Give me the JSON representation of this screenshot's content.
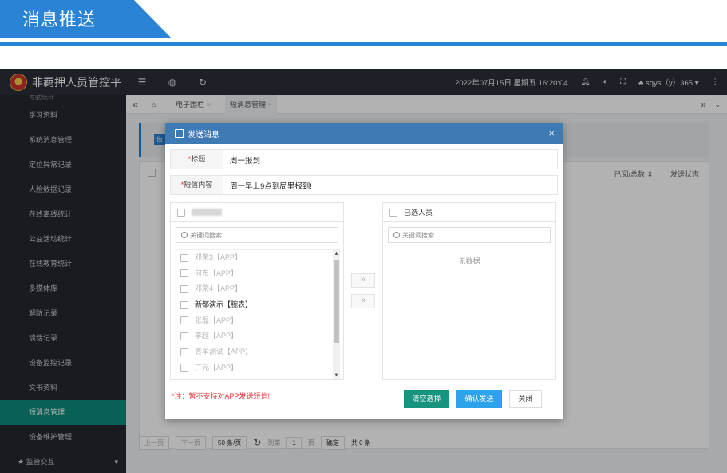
{
  "banner": {
    "title": "消息推送"
  },
  "app": {
    "title": "非羁押人员管控平",
    "datetime": "2022年07月15日 星期五 16:20:04",
    "user": "sqys（y）365"
  },
  "sidebar": {
    "items": [
      {
        "label": "考勤统计",
        "state": "cut"
      },
      {
        "label": "学习资料"
      },
      {
        "label": "系统消息管理"
      },
      {
        "label": "定位异常记录"
      },
      {
        "label": "人脸数据记录"
      },
      {
        "label": "在线离线统计"
      },
      {
        "label": "公益活动统计"
      },
      {
        "label": "在线教育统计"
      },
      {
        "label": "多媒体库"
      },
      {
        "label": "解防记录"
      },
      {
        "label": "谈话记录"
      },
      {
        "label": "设备监控记录"
      },
      {
        "label": "文书资料"
      },
      {
        "label": "短消息管理",
        "state": "active"
      },
      {
        "label": "设备维护管理"
      },
      {
        "label": "监管交互",
        "state": "group"
      }
    ]
  },
  "tabs": {
    "items": [
      "电子围栏",
      "短消息管理"
    ]
  },
  "main": {
    "col_read": "已阅/总数",
    "col_status": "发送状态",
    "tag": "告"
  },
  "pager": {
    "prev": "上一页",
    "next": "下一页",
    "per_page": "50 条/页",
    "goto": "到第",
    "page": "1",
    "page_unit": "页",
    "confirm": "确定",
    "total": "共 0 条"
  },
  "dialog": {
    "title": "发送消息",
    "subject_label": "标题",
    "subject_value": "周一报到",
    "content_label": "短信内容",
    "content_value": "周一早上9点到局里报到!",
    "left_search_placeholder": "关键词搜索",
    "right_header": "已选人员",
    "right_search_placeholder": "关键词搜索",
    "no_data": "无数据",
    "list": [
      {
        "name": "邓荣3【APP】",
        "enabled": false
      },
      {
        "name": "何东【APP】",
        "enabled": false
      },
      {
        "name": "邓荣4【APP】",
        "enabled": false
      },
      {
        "name": "新都演示【腕表】",
        "enabled": true
      },
      {
        "name": "张磊【APP】",
        "enabled": false
      },
      {
        "name": "李超【APP】",
        "enabled": false
      },
      {
        "name": "青羊测试【APP】",
        "enabled": false
      },
      {
        "name": "广元【APP】",
        "enabled": false
      }
    ],
    "note": "*注：暂不支持对APP发送短信!",
    "btn_clear": "清空选择",
    "btn_send": "确认发送",
    "btn_close": "关闭"
  },
  "colors": {
    "banner": "#2b83d6",
    "dialog_header": "#3e7ab3",
    "accent_green": "#16947f",
    "accent_blue": "#2ca3ea"
  }
}
